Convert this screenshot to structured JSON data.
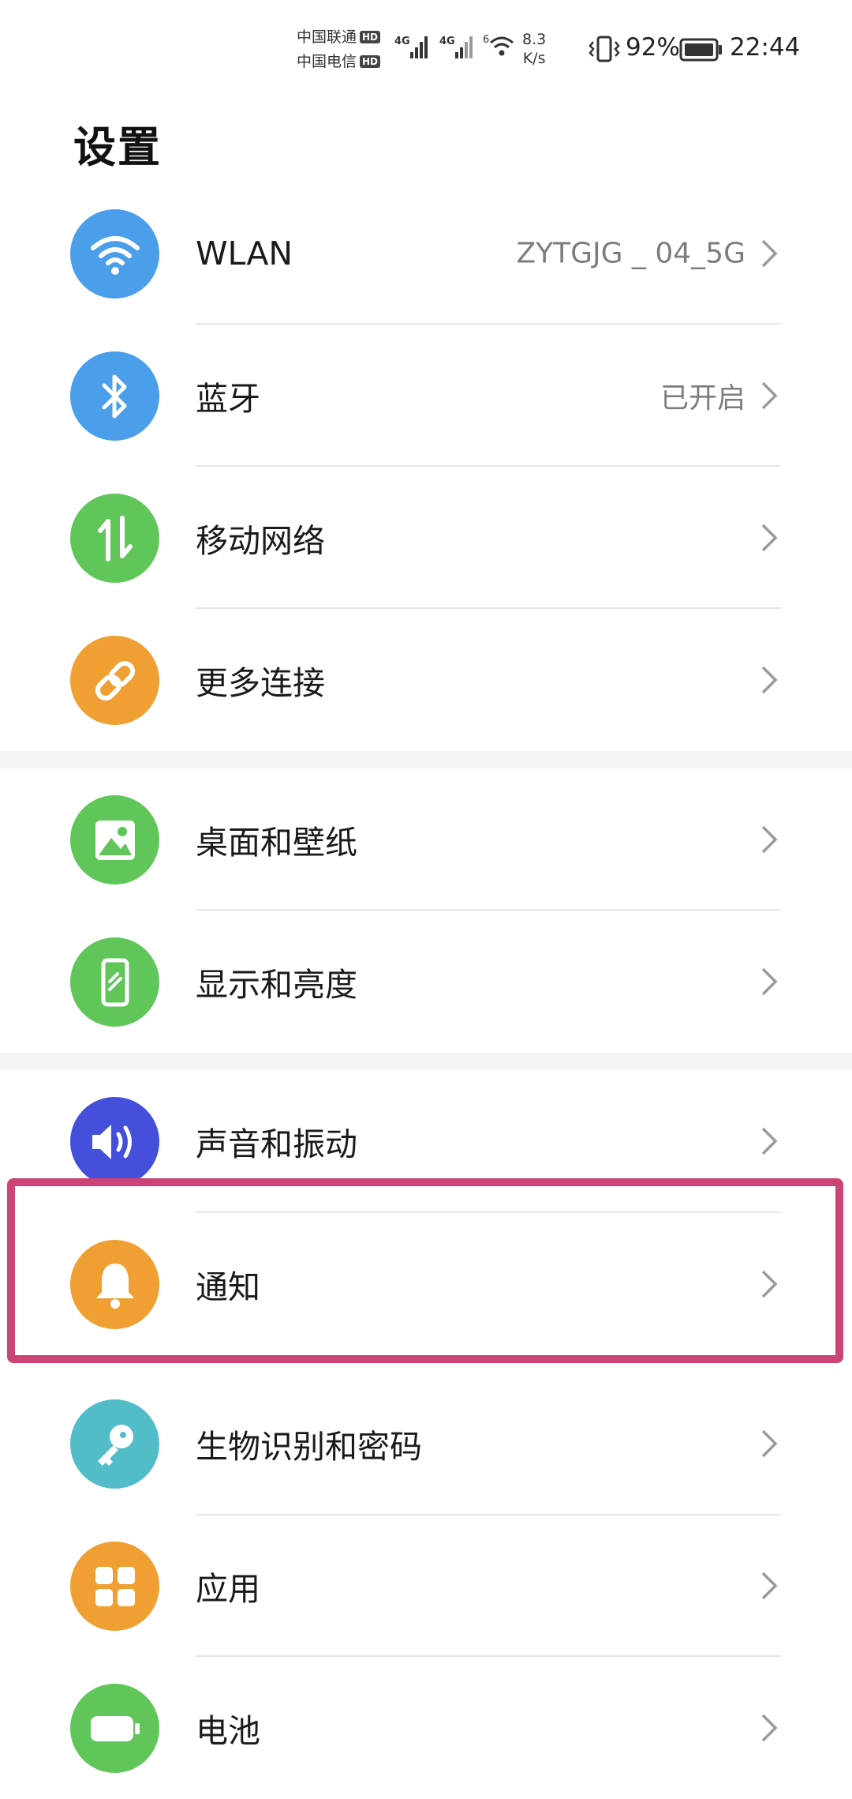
{
  "status_bar": {
    "carrier1": "中国联通",
    "carrier2": "中国电信",
    "hd_badge": "HD",
    "net1": "4G",
    "net2": "4G",
    "wifi_gen": "6",
    "speed_value": "8.3",
    "speed_unit": "K/s",
    "battery_pct": "92%",
    "time": "22:44"
  },
  "page": {
    "title": "设置"
  },
  "settings_items": [
    {
      "label": "WLAN",
      "value": "ZYTGJG _ 04_5G",
      "icon": "wifi-icon",
      "color": "#4a9eea"
    },
    {
      "label": "蓝牙",
      "value": "已开启",
      "icon": "bluetooth-icon",
      "color": "#4a9eea"
    },
    {
      "label": "移动网络",
      "value": "",
      "icon": "mobile-data-icon",
      "color": "#60c65a"
    },
    {
      "label": "更多连接",
      "value": "",
      "icon": "link-icon",
      "color": "#f0a032"
    },
    {
      "label": "桌面和壁纸",
      "value": "",
      "icon": "wallpaper-icon",
      "color": "#60c65a"
    },
    {
      "label": "显示和亮度",
      "value": "",
      "icon": "display-icon",
      "color": "#60c65a"
    },
    {
      "label": "声音和振动",
      "value": "",
      "icon": "sound-icon",
      "color": "#4450dc"
    },
    {
      "label": "通知",
      "value": "",
      "icon": "bell-icon",
      "color": "#f0a032"
    },
    {
      "label": "生物识别和密码",
      "value": "",
      "icon": "key-icon",
      "color": "#52bcc8"
    },
    {
      "label": "应用",
      "value": "",
      "icon": "apps-icon",
      "color": "#f0a032"
    },
    {
      "label": "电池",
      "value": "",
      "icon": "battery-icon",
      "color": "#60c65a"
    }
  ],
  "highlight_color": "#cc4476"
}
